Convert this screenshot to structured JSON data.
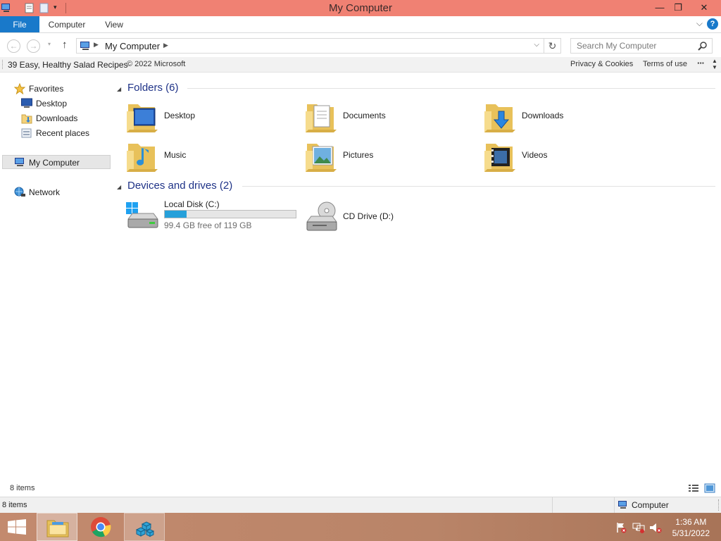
{
  "window": {
    "title": "My Computer"
  },
  "ribbon": {
    "tabs": [
      "File",
      "Computer",
      "View"
    ],
    "help": "?"
  },
  "address": {
    "crumb": "My Computer",
    "search_placeholder": "Search My Computer"
  },
  "infobar": {
    "headline": "39 Easy, Healthy Salad Recipes",
    "copyright": "© 2022 Microsoft",
    "privacy": "Privacy & Cookies",
    "terms": "Terms of use",
    "more": "···"
  },
  "nav": {
    "favorites": "Favorites",
    "desktop": "Desktop",
    "downloads": "Downloads",
    "recent": "Recent places",
    "mycomputer": "My Computer",
    "network": "Network"
  },
  "folders": {
    "header": "Folders (6)",
    "items": [
      "Desktop",
      "Documents",
      "Downloads",
      "Music",
      "Pictures",
      "Videos"
    ]
  },
  "devices": {
    "header": "Devices and drives (2)",
    "drives": [
      {
        "name": "Local Disk (C:)",
        "free_text": "99.4 GB free of 119 GB",
        "used_fraction": 0.165
      },
      {
        "name": "CD Drive (D:)"
      }
    ]
  },
  "status": {
    "items_count": "8 items",
    "bottom_count": "8 items",
    "zone": "Computer"
  },
  "taskbar": {
    "time": "1:36 AM",
    "date": "5/31/2022"
  },
  "colors": {
    "titlebar": "#f08173",
    "accent": "#1979ca",
    "link_title": "#1e3287",
    "progress": "#26a0da"
  }
}
